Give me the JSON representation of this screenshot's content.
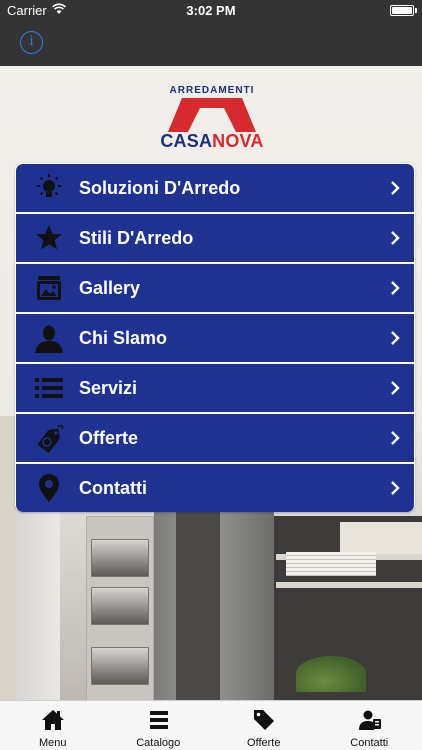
{
  "status_bar": {
    "carrier": "Carrier",
    "time": "3:02 PM"
  },
  "nav": {
    "info_label": "i"
  },
  "logo": {
    "tagline": "ARREDAMENTI",
    "name_part1": "CASA",
    "name_part2": "NOVA"
  },
  "colors": {
    "menu_blue": "#1f3291",
    "logo_blue": "#1c2f7a",
    "logo_red": "#d72a2f",
    "info_blue": "#2f7cf6"
  },
  "menu": {
    "items": [
      {
        "label": "Soluzioni D'Arredo",
        "icon": "lightbulb-icon"
      },
      {
        "label": "Stili D'Arredo",
        "icon": "star-icon"
      },
      {
        "label": "Gallery",
        "icon": "gallery-icon"
      },
      {
        "label": "Chi Slamo",
        "icon": "user-icon"
      },
      {
        "label": "Servizi",
        "icon": "list-icon"
      },
      {
        "label": "Offerte",
        "icon": "price-tag-icon"
      },
      {
        "label": "Contatti",
        "icon": "map-pin-icon"
      }
    ]
  },
  "tabbar": {
    "tabs": [
      {
        "label": "Menu",
        "icon": "home-icon"
      },
      {
        "label": "Catalogo",
        "icon": "hamburger-icon"
      },
      {
        "label": "Offerte",
        "icon": "tag-icon"
      },
      {
        "label": "Contatti",
        "icon": "contact-person-icon"
      }
    ]
  }
}
